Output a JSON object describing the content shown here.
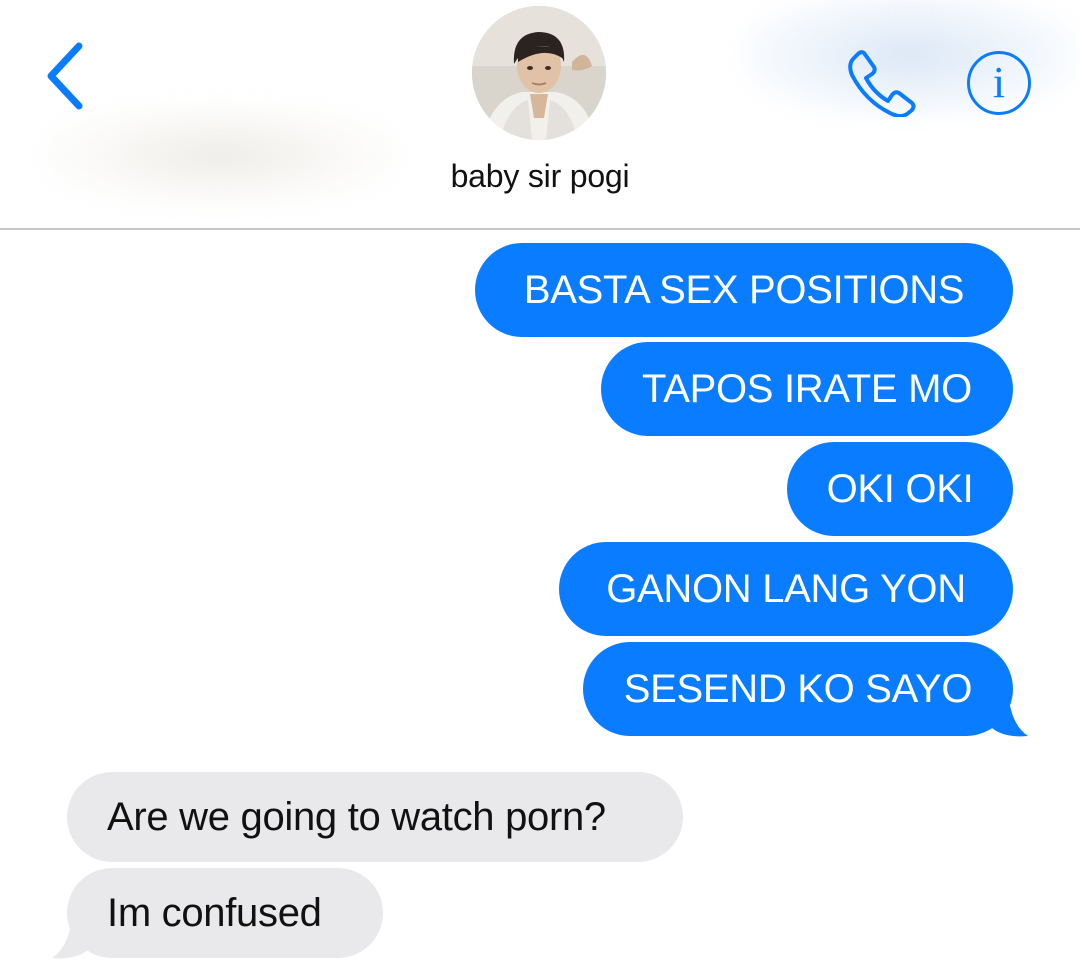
{
  "header": {
    "contact_name": "baby sir pogi",
    "back_icon": "chevron-left-icon",
    "call_icon": "phone-icon",
    "info_icon": "info-icon",
    "info_glyph": "i",
    "accent_color": "#0a7cff"
  },
  "messages": {
    "sent": [
      "BASTA SEX POSITIONS",
      "TAPOS IRATE MO",
      "OKI OKI",
      "GANON LANG YON",
      "SESEND KO SAYO"
    ],
    "received": [
      "Are we going to watch porn?",
      "Im confused"
    ]
  },
  "colors": {
    "sent_bubble": "#0a7cff",
    "received_bubble": "#e9e9eb",
    "divider": "#c8c8cc"
  }
}
